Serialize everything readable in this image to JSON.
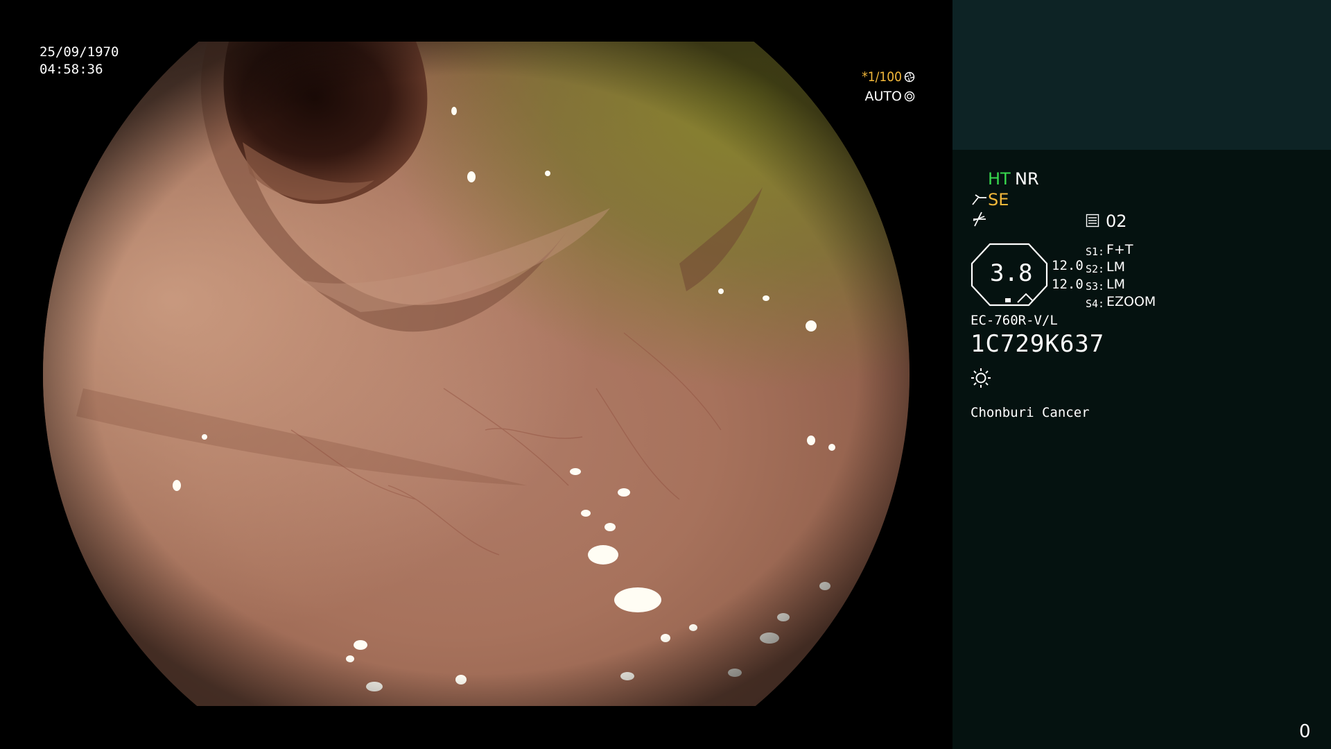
{
  "overlay": {
    "date": "25/09/1970",
    "time": "04:58:36",
    "shutter": "*1/100",
    "shutter_icon": "aperture-icon",
    "auto": "AUTO",
    "auto_icon": "iris-icon"
  },
  "panel": {
    "ht": "HT",
    "nr": "NR",
    "se_icon": "scope-tip-icon",
    "se": "SE",
    "fx_icon": "structure-enhance-icon",
    "mem_icon": "memory-icon",
    "mem": "02",
    "zoom": "3.8",
    "val_a": "12.0",
    "val_b": "12.0",
    "switches": [
      {
        "key": "S1:",
        "value": "F+T"
      },
      {
        "key": "S2:",
        "value": "LM"
      },
      {
        "key": "S3:",
        "value": "LM"
      },
      {
        "key": "S4:",
        "value": "EZOOM"
      }
    ],
    "scope_model": "EC-760R-V/L",
    "scope_serial": "1C729K637",
    "light_icon": "light-source-icon",
    "institution": "Chonburi Cancer",
    "counter": "0"
  },
  "colors": {
    "ht_green": "#38d84e",
    "accent_orange": "#f3b83a",
    "panel_bg": "#051210",
    "panel_top": "#0d2325",
    "tissue": "#b58068"
  }
}
